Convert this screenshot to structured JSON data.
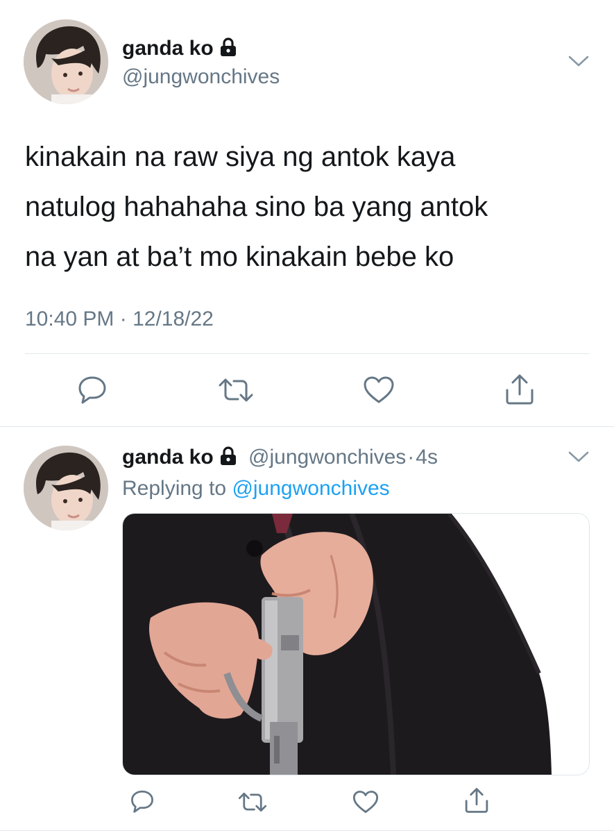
{
  "main_tweet": {
    "display_name": "ganda ko",
    "handle": "@jungwonchives",
    "text_lines": [
      "kinakain na raw siya ng antok kaya",
      "natulog hahahaha sino ba yang antok",
      "na yan at ba’t mo kinakain bebe ko"
    ],
    "timestamp": "10:40 PM · 12/18/22",
    "lock_icon": "lock-icon",
    "actions": [
      "reply-icon",
      "retweet-icon",
      "like-icon",
      "share-icon"
    ]
  },
  "reply_tweet": {
    "display_name": "ganda ko",
    "handle": "@jungwonchives",
    "separator": "·",
    "age": "4s",
    "replying_label": "Replying to",
    "replying_handle": "@jungwonchives",
    "media_icon": "photo-gun-hands",
    "actions": [
      "reply-icon",
      "retweet-icon",
      "like-icon",
      "share-icon"
    ]
  },
  "colors": {
    "text": "#14171a",
    "secondary": "#657786",
    "accent": "#1da1f2",
    "divider": "#e1e8ed"
  }
}
